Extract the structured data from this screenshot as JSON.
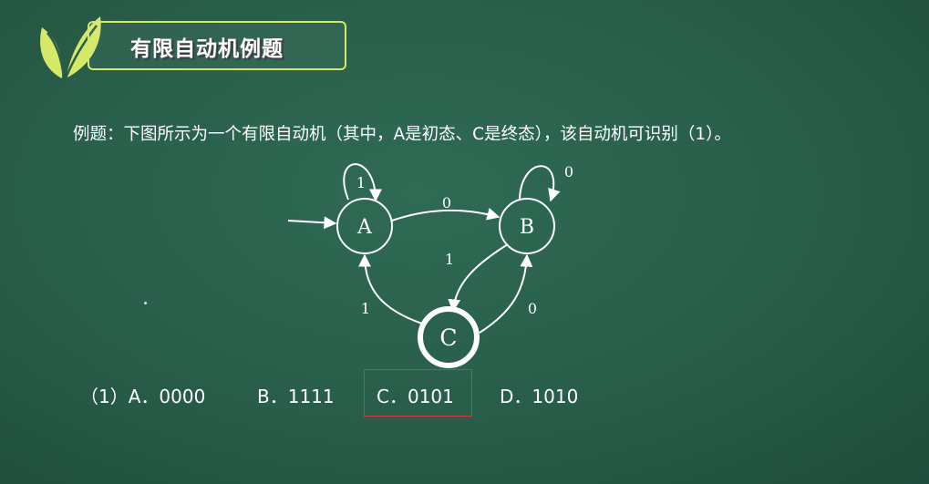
{
  "header": {
    "title": "有限自动机例题"
  },
  "question": {
    "text": "例题：下图所示为一个有限自动机（其中，A是初态、C是终态），该自动机可识别（1）。"
  },
  "automaton": {
    "states": {
      "a": "A",
      "b": "B",
      "c": "C"
    },
    "edge_labels": {
      "a_self": "1",
      "a_to_b": "0",
      "b_self": "0",
      "b_to_c": "1",
      "c_to_a": "1",
      "c_to_b": "0"
    }
  },
  "options": {
    "a": "（1）A．0000",
    "b": "B．1111",
    "c": "C．0101",
    "d": "D．1010"
  },
  "colors": {
    "board": "#285d49",
    "logo_leaf": "#d6e86a",
    "highlight_box": "#d23b3b"
  }
}
